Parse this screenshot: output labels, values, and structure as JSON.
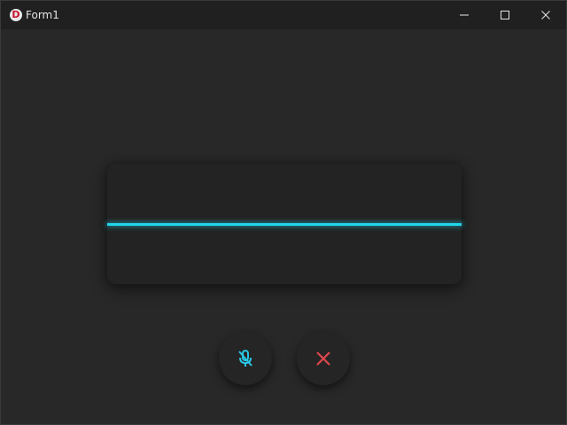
{
  "window": {
    "title": "Form1",
    "app_icon_letter": "D"
  },
  "title_controls": {
    "minimize": "minimize-icon",
    "maximize": "maximize-icon",
    "close": "close-icon"
  },
  "waveform": {
    "color": "#1fd6ea",
    "level": 0
  },
  "buttons": {
    "mic": {
      "icon": "microphone-off-icon",
      "color": "#29c7e6"
    },
    "cancel": {
      "icon": "close-x-icon",
      "color": "#e0474c"
    }
  }
}
